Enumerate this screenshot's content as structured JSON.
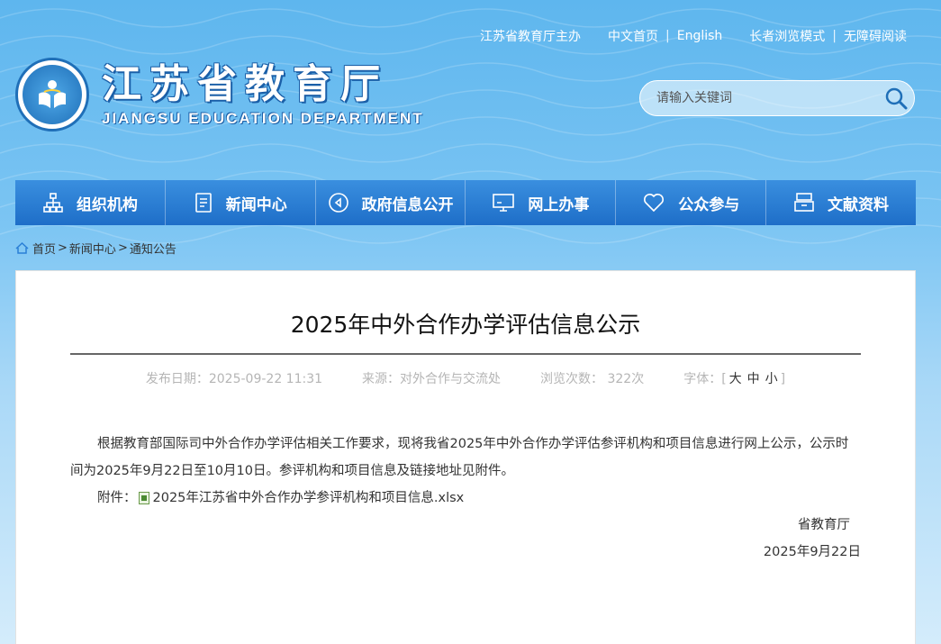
{
  "toplinks": {
    "sponsor": "江苏省教育厅主办",
    "home_cn": "中文首页",
    "english": "English",
    "elder_mode": "长者浏览模式",
    "accessible": "无障碍阅读"
  },
  "logo": {
    "cn": "江苏省教育厅",
    "en": "JIANGSU EDUCATION DEPARTMENT"
  },
  "search": {
    "placeholder": "请输入关键词"
  },
  "nav": [
    {
      "label": "组织机构",
      "icon": "org-chart-icon"
    },
    {
      "label": "新闻中心",
      "icon": "document-icon"
    },
    {
      "label": "政府信息公开",
      "icon": "play-circle-icon"
    },
    {
      "label": "网上办事",
      "icon": "monitor-icon"
    },
    {
      "label": "公众参与",
      "icon": "heart-icon"
    },
    {
      "label": "文献资料",
      "icon": "archive-icon"
    }
  ],
  "breadcrumb": {
    "home": "首页",
    "news": "新闻中心",
    "notice": "通知公告",
    "sep": ">"
  },
  "article": {
    "title": "2025年中外合作办学评估信息公示",
    "publish_date": "发布日期：2025-09-22 11:31",
    "source": "来源：对外合作与交流处",
    "views": "浏览次数：  322次",
    "font_label": "字体：[",
    "font_large": "大",
    "font_medium": "中",
    "font_small": "小",
    "font_close": "]",
    "paragraph": "根据教育部国际司中外合作办学评估相关工作要求，现将我省2025年中外合作办学评估参评机构和项目信息进行网上公示，公示时间为2025年9月22日至10月10日。参评机构和项目信息及链接地址见附件。",
    "attachment_label": "附件：",
    "attachment_name": "2025年江苏省中外合作办学参评机构和项目信息.xlsx",
    "signature": "省教育厅",
    "date": "2025年9月22日"
  },
  "colors": {
    "nav_bg": "#2a7fd6",
    "header_bg": "#6bbdf0",
    "logo_blue": "#1f6fb8"
  }
}
